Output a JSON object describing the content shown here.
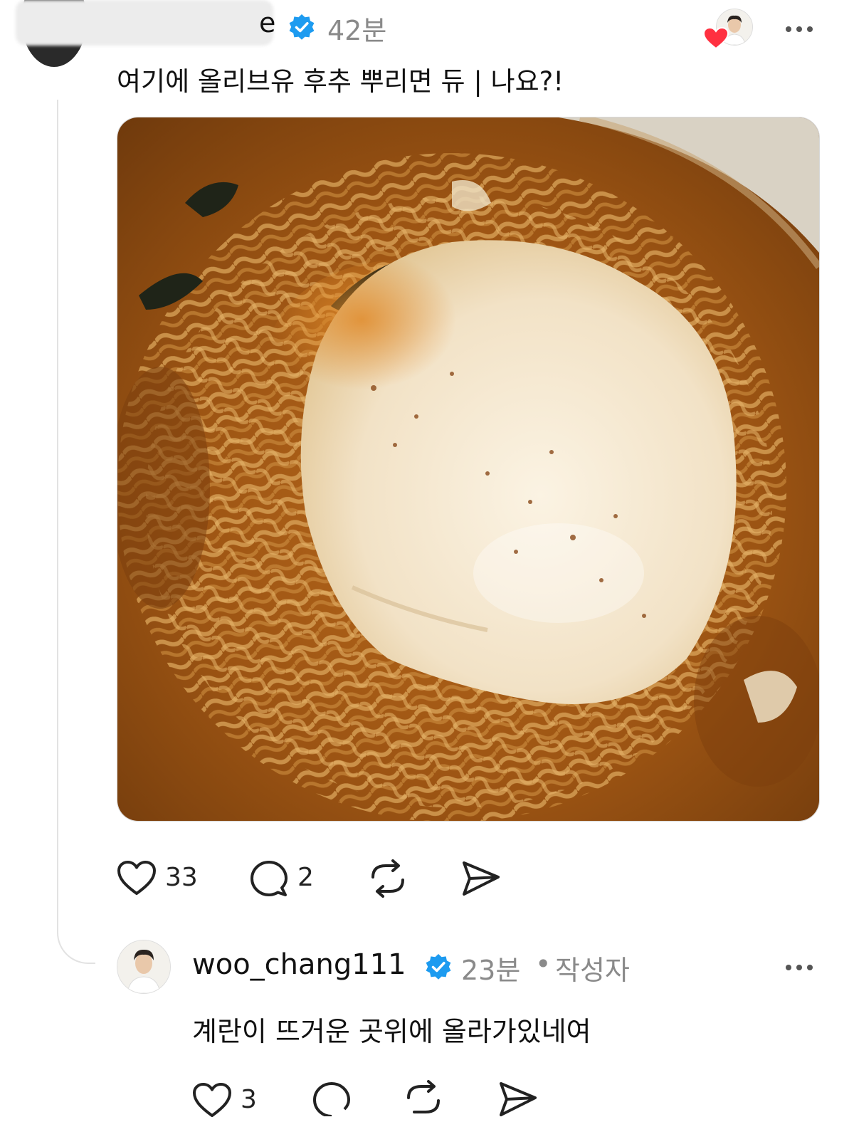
{
  "top_comment": {
    "username_visible_tail": "e",
    "time": "42분",
    "text": "여기에 올리브유 후추 뿌리면 듀 | 나요?!",
    "likes": "33",
    "replies": "2",
    "more_icon": "more-horizontal-icon",
    "verified_icon": "verified-badge-icon"
  },
  "reply": {
    "username": "woo_chang111",
    "time": "23분",
    "separator": "•",
    "author_label": "작성자",
    "text": "계란이 뜨거운 곳위에 올라가있네여",
    "likes": "3"
  },
  "icons": {
    "like": "heart-icon",
    "comment": "comment-bubble-icon",
    "repost": "repost-icon",
    "share": "send-icon",
    "liked_by_author": "red-heart-icon"
  },
  "colors": {
    "verified_blue": "#1d9bf0",
    "muted_text": "#8a8a8a",
    "heart_red": "#ff3040"
  }
}
